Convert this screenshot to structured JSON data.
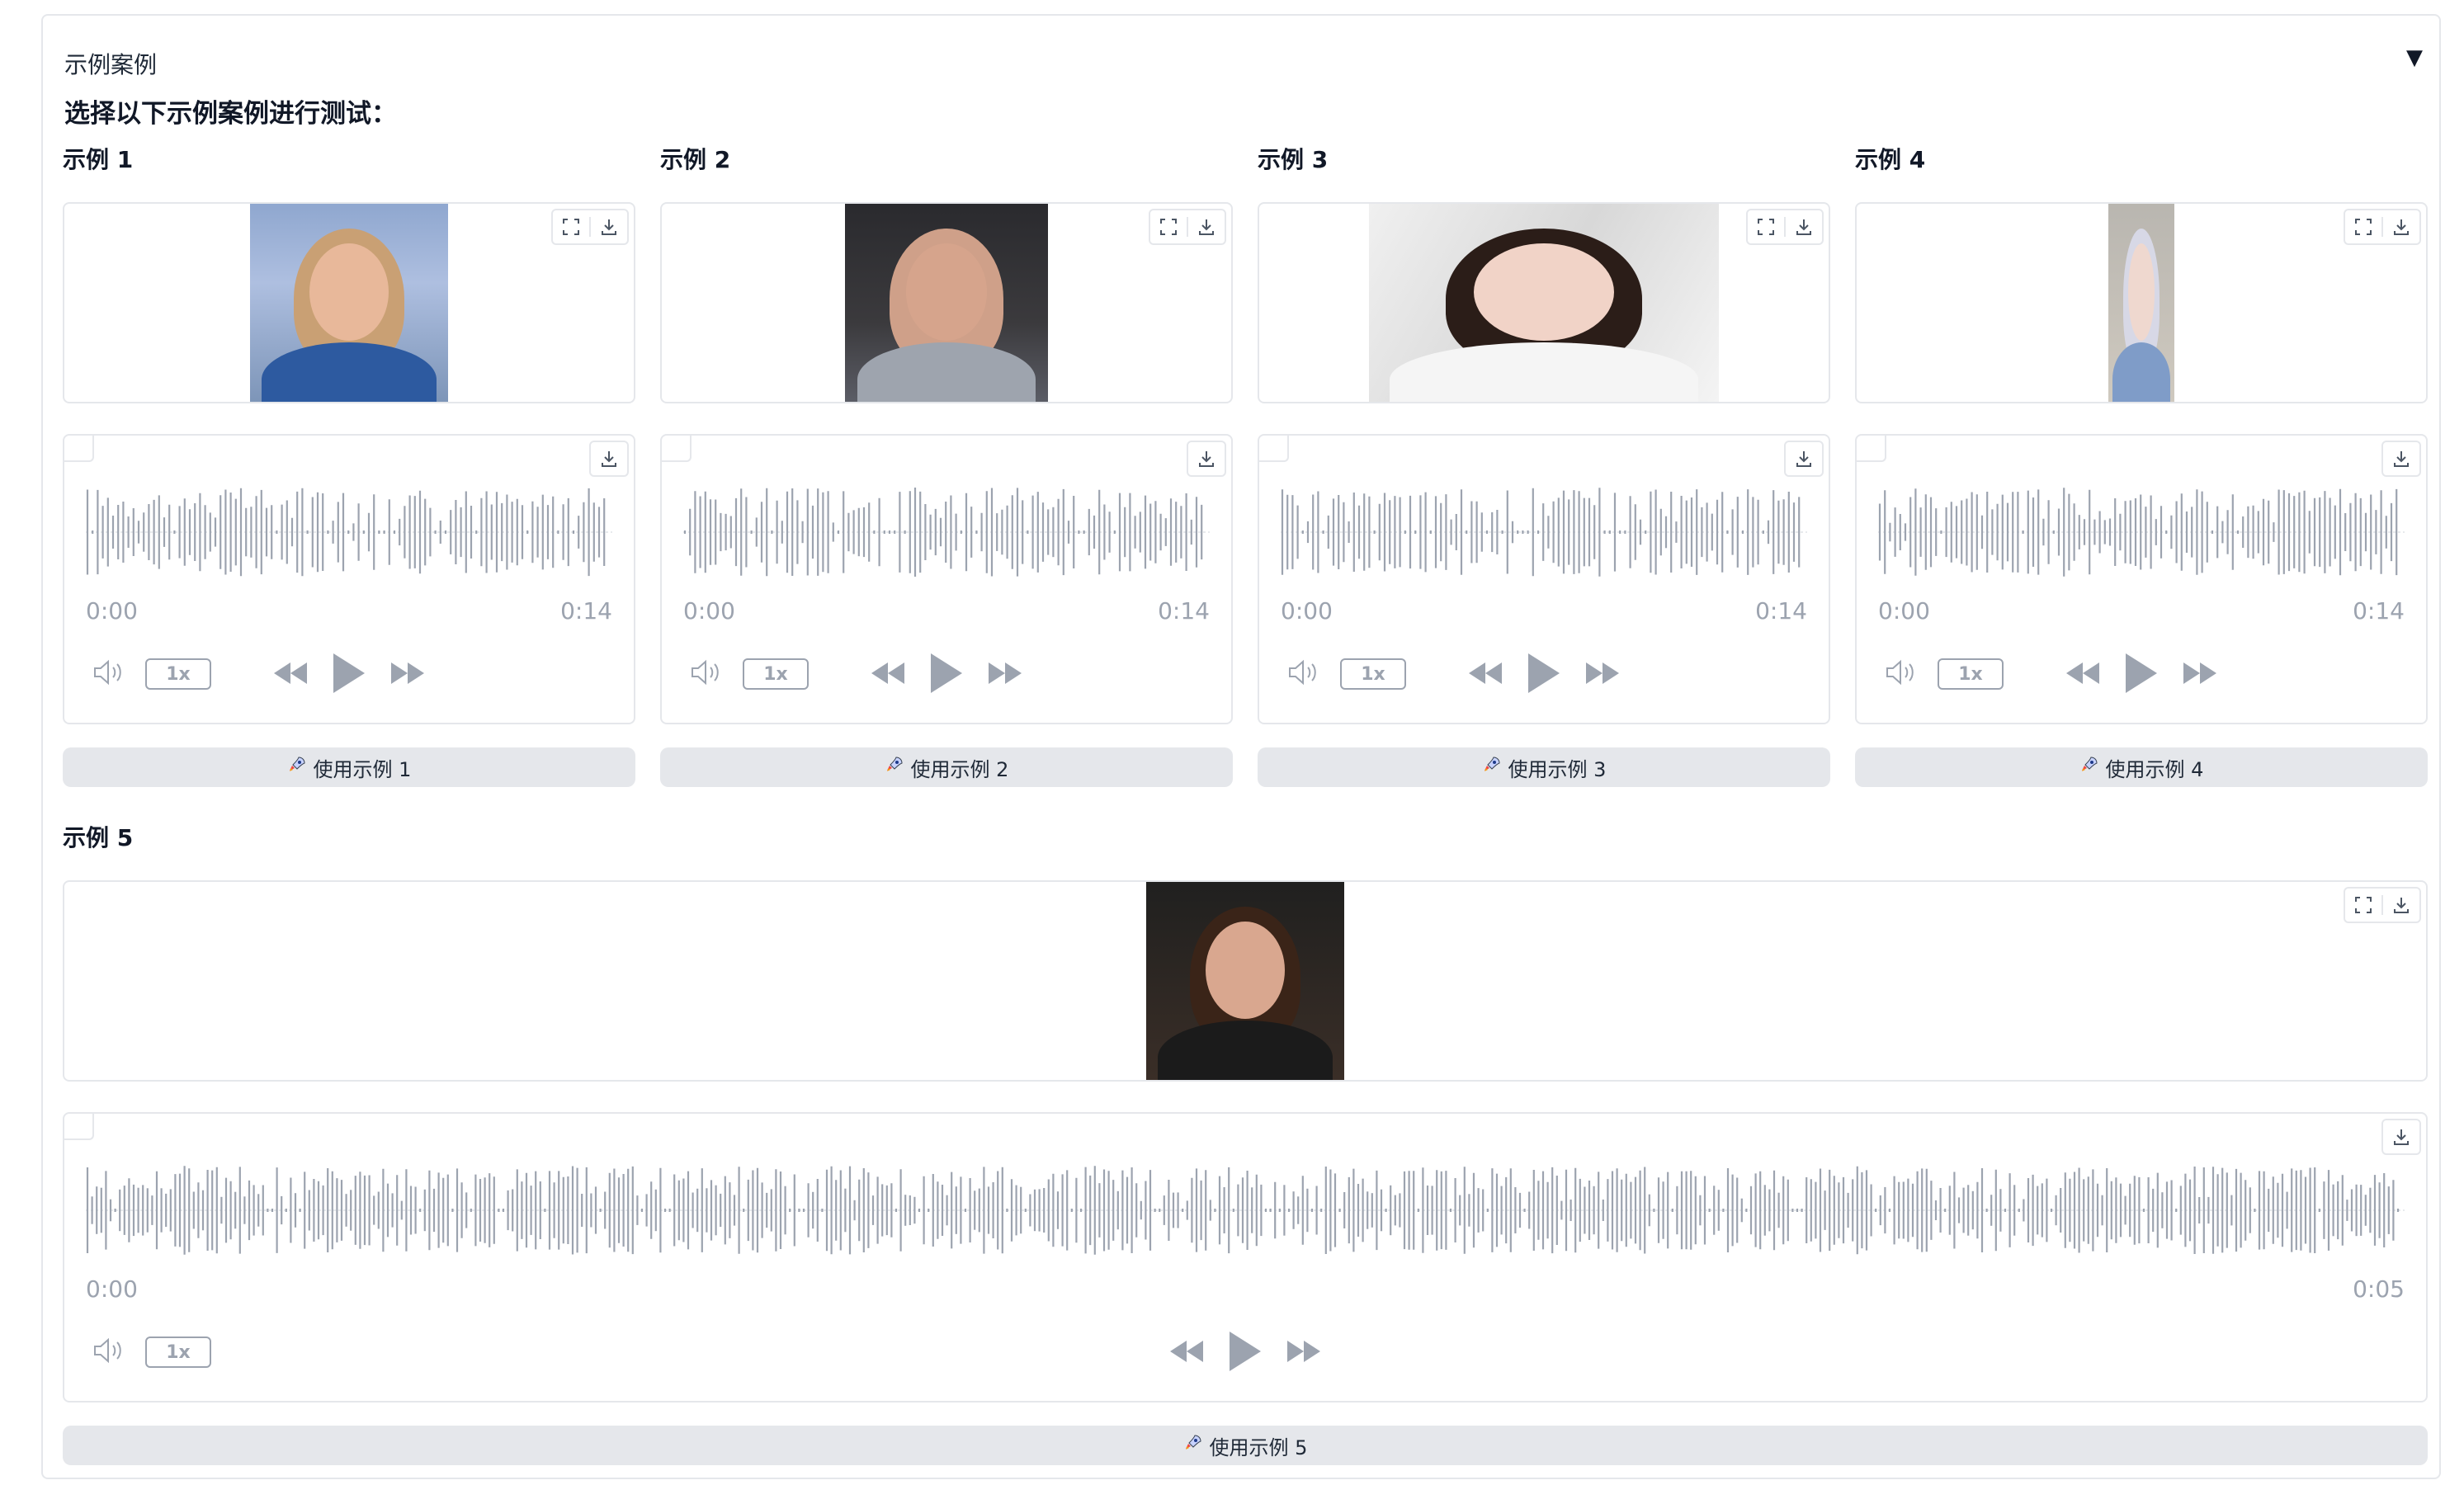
{
  "accordion": {
    "title": "示例案例",
    "toggle": "▼",
    "instruction": "选择以下示例案例进行测试："
  },
  "examples": [
    {
      "title": "示例 1",
      "time_start": "0:00",
      "time_end": "0:14",
      "speed": "1x",
      "button": "使用示例 1"
    },
    {
      "title": "示例 2",
      "time_start": "0:00",
      "time_end": "0:14",
      "speed": "1x",
      "button": "使用示例 2"
    },
    {
      "title": "示例 3",
      "time_start": "0:00",
      "time_end": "0:14",
      "speed": "1x",
      "button": "使用示例 3"
    },
    {
      "title": "示例 4",
      "time_start": "0:00",
      "time_end": "0:14",
      "speed": "1x",
      "button": "使用示例 4"
    },
    {
      "title": "示例 5",
      "time_start": "0:00",
      "time_end": "0:05",
      "speed": "1x",
      "button": "使用示例 5"
    }
  ],
  "icons": {
    "fullscreen": "fullscreen-icon",
    "download": "download-icon",
    "volume": "volume-icon",
    "rewind": "rewind-icon",
    "play": "play-icon",
    "forward": "fast-forward-icon",
    "rocket": "rocket-icon"
  },
  "colors": {
    "border": "#e5e7eb",
    "waveform": "#9ca3af",
    "button_bg": "#e5e7eb",
    "text": "#1f2937"
  }
}
